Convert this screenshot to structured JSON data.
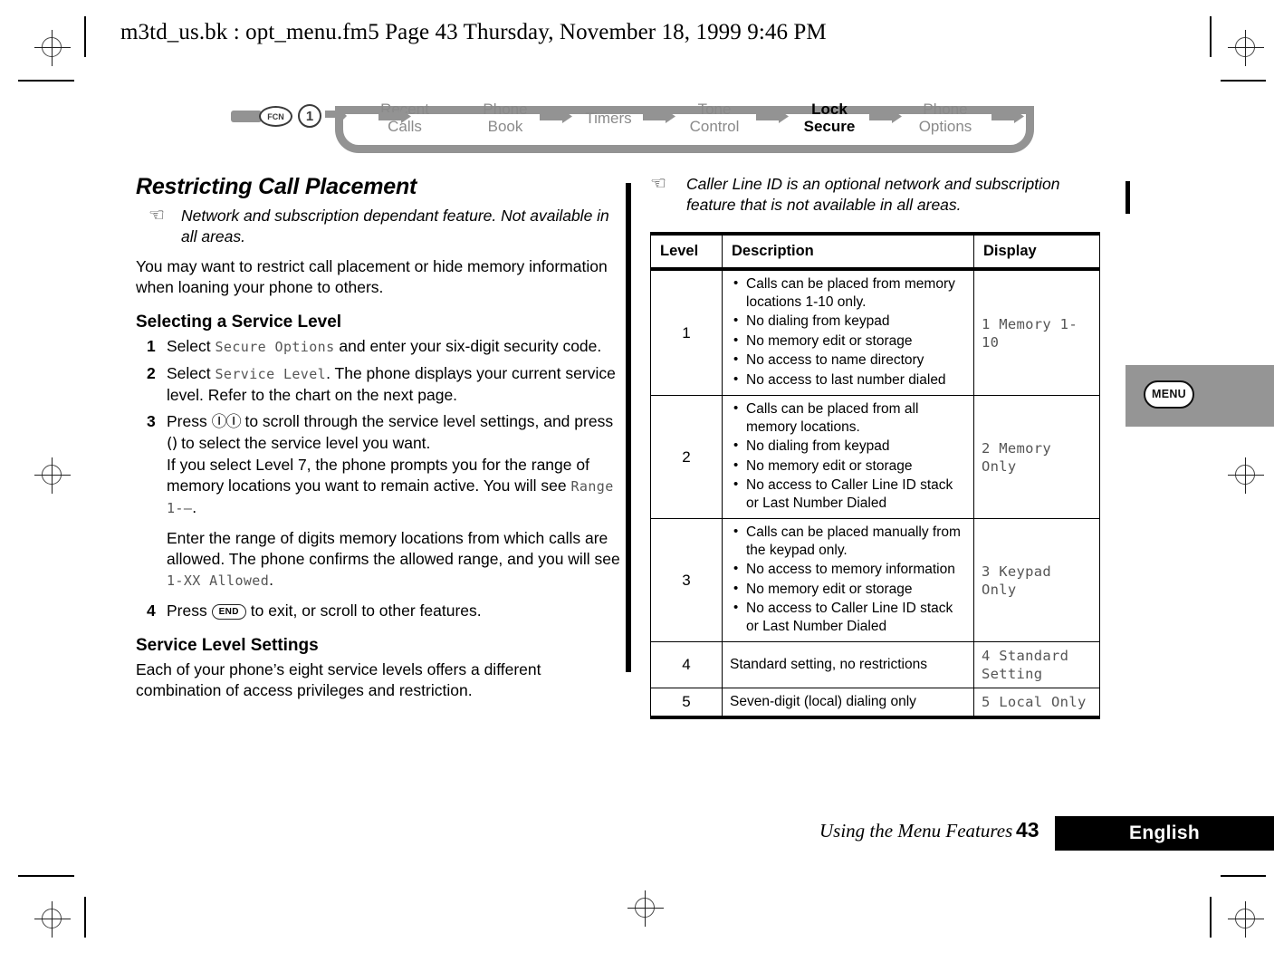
{
  "document": {
    "header_line": "m3td_us.bk : opt_menu.fm5  Page 43  Thursday, November 18, 1999  9:46 PM"
  },
  "nav": {
    "keys": [
      {
        "label": "FCN",
        "name": "fcn-key"
      },
      {
        "label": "1",
        "name": "one-key"
      }
    ],
    "items": [
      {
        "line1": "Recent",
        "line2": "Calls",
        "active": false
      },
      {
        "line1": "Phone",
        "line2": "Book",
        "active": false
      },
      {
        "line1": "Timers",
        "line2": "",
        "active": false
      },
      {
        "line1": "Tone",
        "line2": "Control",
        "active": false
      },
      {
        "line1": "Lock",
        "line2": "Secure",
        "active": true
      },
      {
        "line1": "Phone",
        "line2": "Options",
        "active": false
      }
    ]
  },
  "left_column": {
    "title": "Restricting Call Placement",
    "note": "Network and subscription dependant feature. Not available in all areas.",
    "intro": "You may want to restrict call placement or hide memory information when loaning your phone to others.",
    "subheading_1": "Selecting a Service Level",
    "steps": [
      {
        "num": "1",
        "pre": "Select ",
        "lcd": "Secure Options",
        "post": " and enter your six-digit security code."
      },
      {
        "num": "2",
        "pre": "Select ",
        "lcd": "Service Level",
        "post": ". The phone displays your current service level. Refer to the chart on the next page."
      },
      {
        "num": "3",
        "pre": "Press ",
        "glyph_scroll": "ⒾⒾ",
        "mid": " to scroll through the service level settings, and press ",
        "glyph_select": "()",
        "post": " to select the service level you want."
      },
      {
        "num": "4",
        "pre": "Press ",
        "keycap": "END",
        "post": " to exit, or scroll to other features."
      }
    ],
    "step3_para1_pre": "If you select Level 7, the phone prompts you for the range of memory locations you want to remain active. You will see ",
    "step3_para1_lcd": "Range 1-—",
    "step3_para1_post": ".",
    "step3_para2_pre": "Enter the range of digits memory locations from which calls are allowed. The phone confirms the allowed range, and you will see ",
    "step3_para2_lcd": "1-XX Allowed",
    "step3_para2_post": ".",
    "subheading_2": "Service Level Settings",
    "closing": "Each of your phone’s eight service levels offers a different combination of access privileges and restriction."
  },
  "right_column": {
    "note": "Caller Line ID is an optional network and subscription feature that is not available in all areas.",
    "table": {
      "columns": [
        "Level",
        "Description",
        "Display"
      ],
      "rows": [
        {
          "level": "1",
          "bullets": [
            "Calls can be placed from memory locations 1-10 only.",
            "No dialing from keypad",
            "No memory edit or storage",
            "No access to name directory",
            "No access to last number dialed"
          ],
          "display": "1 Memory 1-10"
        },
        {
          "level": "2",
          "bullets": [
            "Calls can be placed from all memory locations.",
            "No dialing from keypad",
            "No memory edit or storage",
            "No access to Caller Line ID stack or Last Number Dialed"
          ],
          "display": "2 Memory Only"
        },
        {
          "level": "3",
          "bullets": [
            "Calls can be placed manually from the keypad only.",
            "No access to memory information",
            "No memory edit or storage",
            "No access to Caller Line ID stack or Last Number Dialed"
          ],
          "display": "3 Keypad Only"
        },
        {
          "level": "4",
          "text": "Standard setting, no restrictions",
          "display": "4 Standard Setting"
        },
        {
          "level": "5",
          "text": "Seven-digit (local) dialing only",
          "display": "5 Local Only"
        }
      ]
    }
  },
  "side_tab": {
    "button_label": "MENU"
  },
  "footer": {
    "chapter": "Using the Menu Features",
    "page_number": "43",
    "language": "English"
  },
  "colors": {
    "rail_gray": "#939393",
    "nav_inactive": "#8a8a8a",
    "nav_active": "#000000",
    "tab_gray": "#959595",
    "lcd_text": "#555555"
  }
}
